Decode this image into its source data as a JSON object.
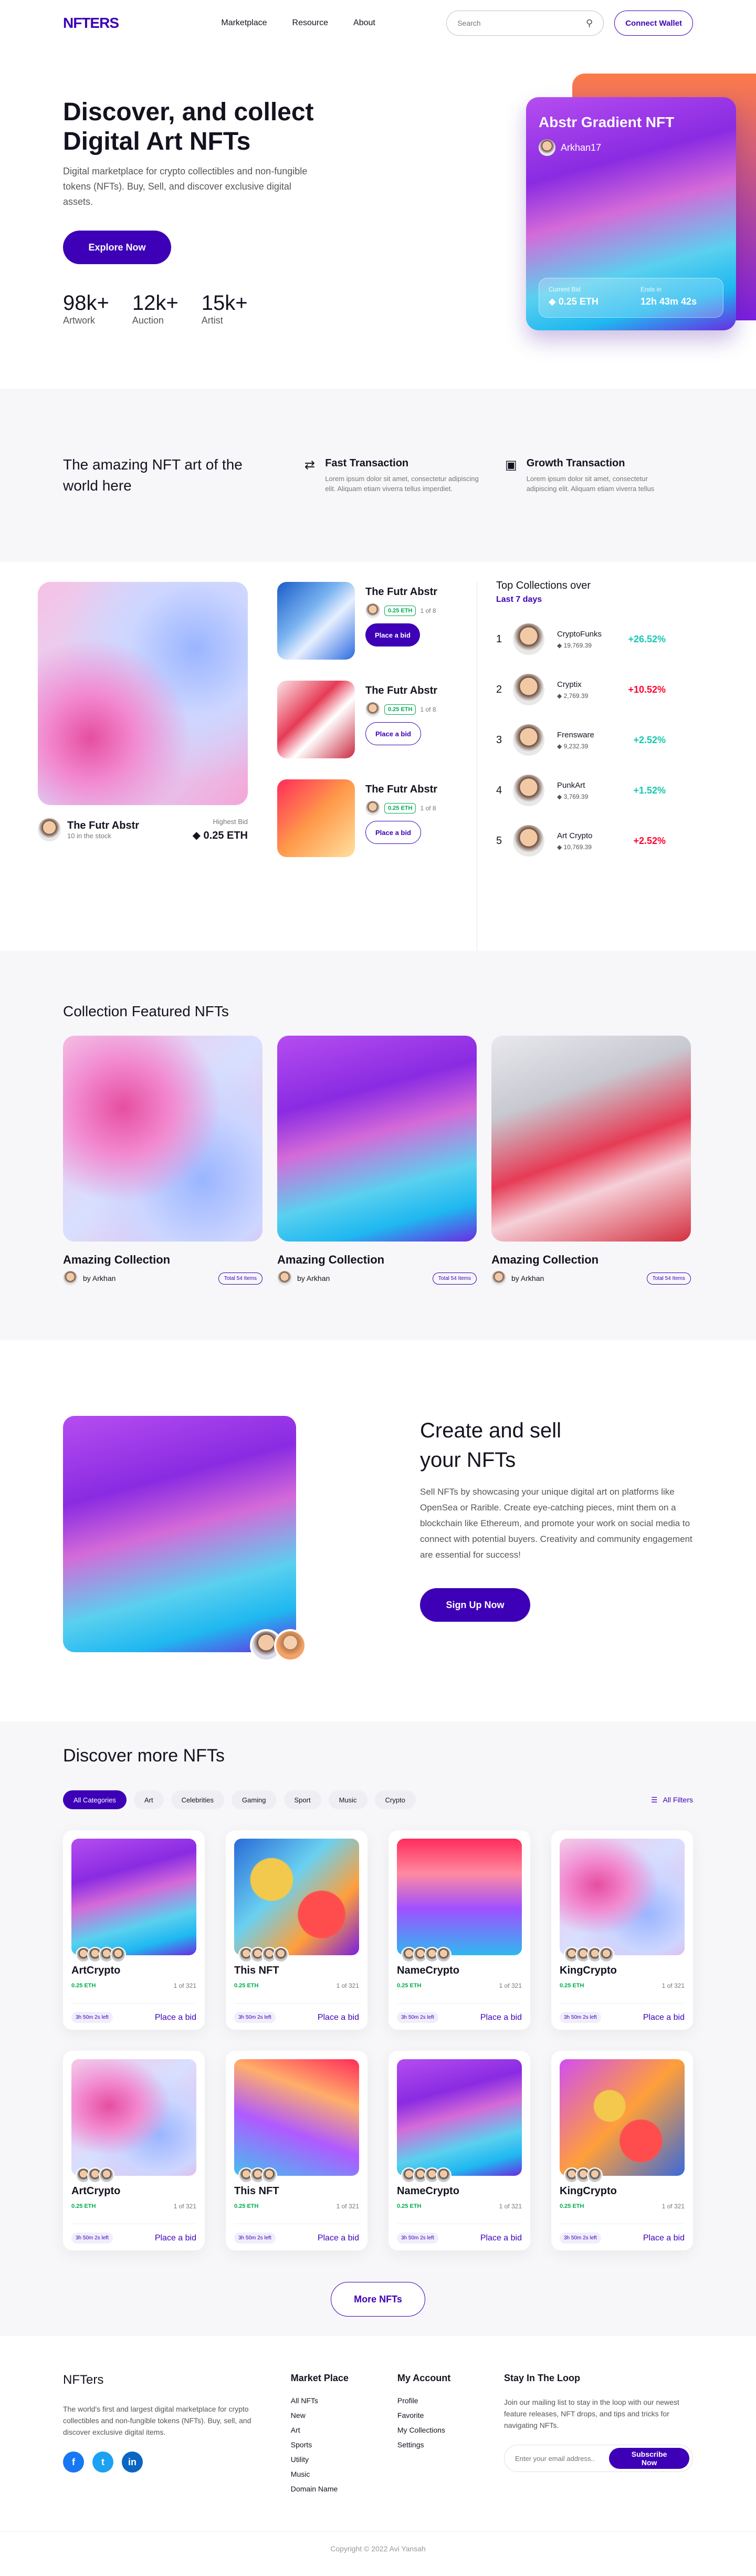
{
  "header": {
    "logo": "NFTERS",
    "nav": [
      "Marketplace",
      "Resource",
      "About"
    ],
    "search_placeholder": "Search",
    "connect": "Connect Wallet"
  },
  "hero": {
    "title": "Discover, and collect Digital Art  NFTs",
    "desc": "Digital marketplace for crypto collectibles and non-fungible tokens (NFTs). Buy, Sell, and discover exclusive digital assets.",
    "cta": "Explore Now",
    "stats": [
      {
        "n": "98k+",
        "l": "Artwork"
      },
      {
        "n": "12k+",
        "l": "Auction"
      },
      {
        "n": "15k+",
        "l": "Artist"
      }
    ],
    "card": {
      "title": "Abstr Gradient NFT",
      "owner": "Arkhan17",
      "bid_label": "Current Bid",
      "bid": "0.25 ETH",
      "ends_label": "Ends in",
      "ends": "12h 43m 42s"
    }
  },
  "features": {
    "title": "The amazing NFT art of the world here",
    "items": [
      {
        "t": "Fast Transaction",
        "d": "Lorem ipsum dolor sit amet, consectetur adipiscing elit. Aliquam etiam viverra tellus imperdiet."
      },
      {
        "t": "Growth Transaction",
        "d": "Lorem ipsum dolor sit amet, consectetur adipiscing elit. Aliquam etiam viverra tellus"
      }
    ]
  },
  "trending": {
    "big": {
      "title": "The Futr Abstr",
      "sub": "10 in the stock",
      "bid_label": "Highest Bid",
      "bid": "0.25 ETH"
    },
    "items": [
      {
        "title": "The Futr Abstr",
        "eth": "0.25 ETH",
        "of": "1 of 8",
        "btn": "Place a bid"
      },
      {
        "title": "The Futr Abstr",
        "eth": "0.25 ETH",
        "of": "1 of 8",
        "btn": "Place a bid"
      },
      {
        "title": "The Futr Abstr",
        "eth": "0.25 ETH",
        "of": "1 of 8",
        "btn": "Place a bid"
      }
    ],
    "top_title": "Top Collections over",
    "period": "Last 7 days",
    "top": [
      {
        "i": "1",
        "n": "CryptoFunks",
        "v": "19,769.39",
        "p": "+26.52%"
      },
      {
        "i": "2",
        "n": "Cryptix",
        "v": "2,769.39",
        "p": "+10.52%"
      },
      {
        "i": "3",
        "n": "Frensware",
        "v": "9,232.39",
        "p": "+2.52%"
      },
      {
        "i": "4",
        "n": "PunkArt",
        "v": "3,769.39",
        "p": "+1.52%"
      },
      {
        "i": "5",
        "n": "Art Crypto",
        "v": "10,769.39",
        "p": "+2.52%"
      }
    ]
  },
  "collections": {
    "title": "Collection Featured NFTs",
    "items": [
      {
        "t": "Amazing Collection",
        "by": "by Arkhan",
        "tag": "Total 54 Items"
      },
      {
        "t": "Amazing Collection",
        "by": "by Arkhan",
        "tag": "Total 54 Items"
      },
      {
        "t": "Amazing Collection",
        "by": "by Arkhan",
        "tag": "Total 54 Items"
      }
    ]
  },
  "create": {
    "title": "Create and sell your NFTs",
    "desc": "Sell NFTs by showcasing your unique digital art on platforms like OpenSea or Rarible. Create eye-catching pieces, mint them on a blockchain like Ethereum, and promote your work on social media to connect with potential buyers. Creativity and community engagement are essential for success!",
    "cta": "Sign Up Now"
  },
  "discover": {
    "title": "Discover more NFTs",
    "filters": [
      "All Categories",
      "Art",
      "Celebrities",
      "Gaming",
      "Sport",
      "Music",
      "Crypto"
    ],
    "all_filters": "All Filters",
    "cards": [
      {
        "t": "ArtCrypto",
        "e": "0.25 ETH",
        "o": "1 of 321",
        "l": "3h 50m 2s left",
        "b": "Place a bid"
      },
      {
        "t": "This NFT",
        "e": "0.25 ETH",
        "o": "1 of 321",
        "l": "3h 50m 2s left",
        "b": "Place a bid"
      },
      {
        "t": "NameCrypto",
        "e": "0.25 ETH",
        "o": "1 of 321",
        "l": "3h 50m 2s left",
        "b": "Place a bid"
      },
      {
        "t": "KingCrypto",
        "e": "0.25 ETH",
        "o": "1 of 321",
        "l": "3h 50m 2s left",
        "b": "Place a bid"
      },
      {
        "t": "ArtCrypto",
        "e": "0.25 ETH",
        "o": "1 of 321",
        "l": "3h 50m 2s left",
        "b": "Place a bid"
      },
      {
        "t": "This NFT",
        "e": "0.25 ETH",
        "o": "1 of 321",
        "l": "3h 50m 2s left",
        "b": "Place a bid"
      },
      {
        "t": "NameCrypto",
        "e": "0.25 ETH",
        "o": "1 of 321",
        "l": "3h 50m 2s left",
        "b": "Place a bid"
      },
      {
        "t": "KingCrypto",
        "e": "0.25 ETH",
        "o": "1 of 321",
        "l": "3h 50m 2s left",
        "b": "Place a bid"
      }
    ],
    "more": "More NFTs"
  },
  "footer": {
    "brand": "NFTers",
    "about": "The world's first and largest digital marketplace for crypto collectibles and non-fungible tokens (NFTs). Buy, sell, and discover exclusive digital items.",
    "market_title": "Market Place",
    "market": [
      "All NFTs",
      "New",
      "Art",
      "Sports",
      "Utility",
      "Music",
      "Domain Name"
    ],
    "account_title": "My Account",
    "account": [
      "Profile",
      "Favorite",
      "My Collections",
      "Settings"
    ],
    "stay_title": "Stay In The Loop",
    "stay": "Join our mailing list to stay in the loop with our newest feature releases, NFT drops, and tips and tricks for navigating NFTs.",
    "email_placeholder": "Enter your email address..",
    "subscribe": "Subscribe Now",
    "copyright": "Copyright © 2022 Avi Yansah"
  }
}
